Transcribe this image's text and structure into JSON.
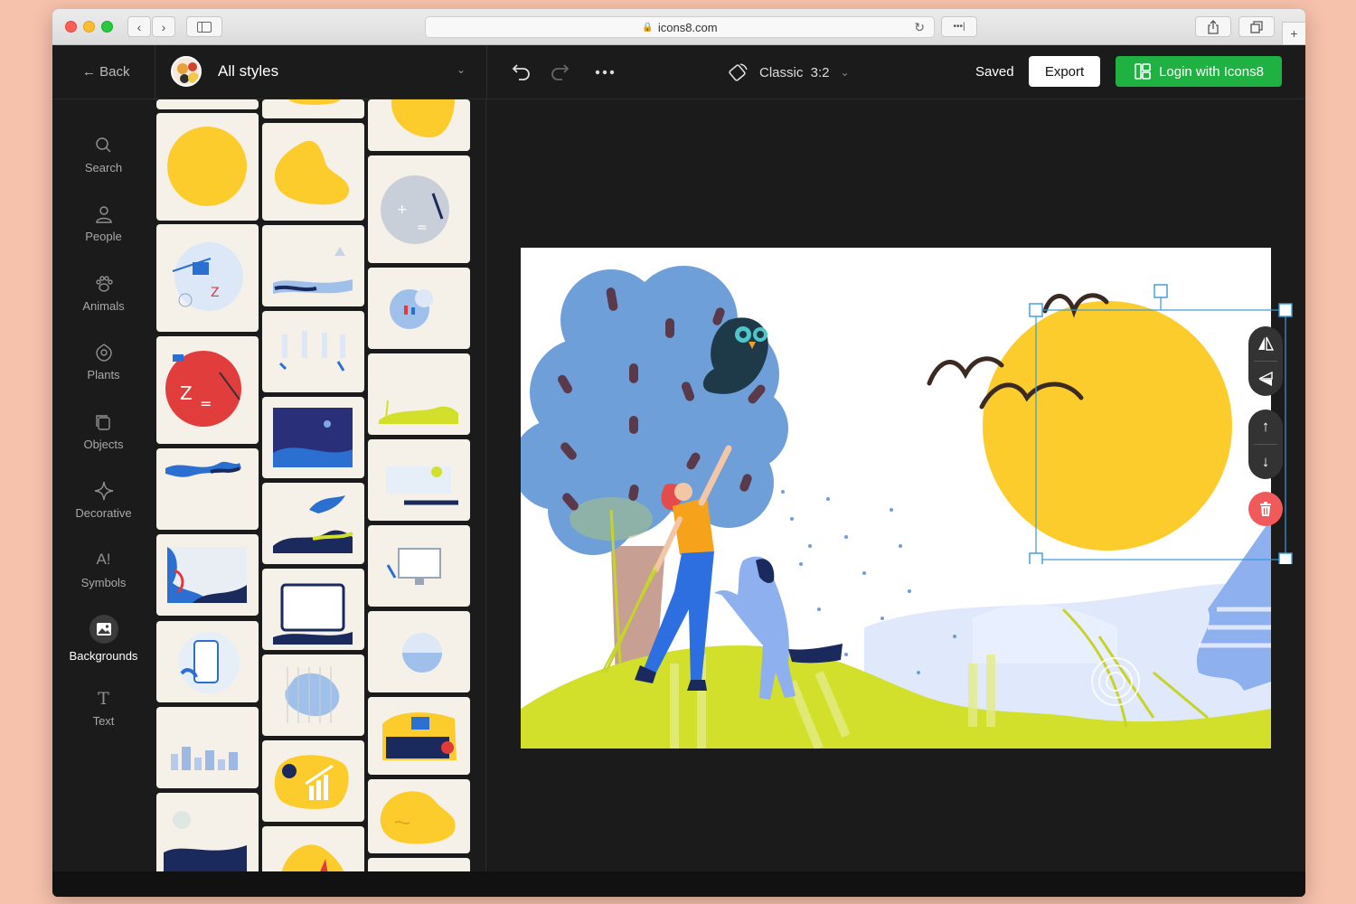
{
  "browser": {
    "url": "icons8.com",
    "buttons": {
      "back": "‹",
      "forward": "›",
      "more": "•••|",
      "newtab": "+"
    }
  },
  "header": {
    "back_label": "Back",
    "style_title": "All styles",
    "canvas_size": "Classic  3:2",
    "saved_label": "Saved",
    "export_label": "Export",
    "login_label": "Login with Icons8"
  },
  "rail": {
    "items": [
      {
        "label": "Search",
        "icon": "search-icon"
      },
      {
        "label": "People",
        "icon": "person-icon"
      },
      {
        "label": "Animals",
        "icon": "paw-icon"
      },
      {
        "label": "Plants",
        "icon": "flower-icon"
      },
      {
        "label": "Objects",
        "icon": "objects-icon"
      },
      {
        "label": "Decorative",
        "icon": "sparkle-icon"
      },
      {
        "label": "Symbols",
        "icon": "symbols-icon"
      },
      {
        "label": "Backgrounds",
        "icon": "image-icon",
        "active": true
      },
      {
        "label": "Text",
        "icon": "text-icon"
      }
    ]
  },
  "colors": {
    "accent_green": "#1fb141",
    "sun_yellow": "#fccc2d",
    "tree_blue": "#6f9fd8",
    "grass_green": "#d2e02b",
    "delete_red": "#f05a5a",
    "selection_blue": "#3a9ad9"
  }
}
